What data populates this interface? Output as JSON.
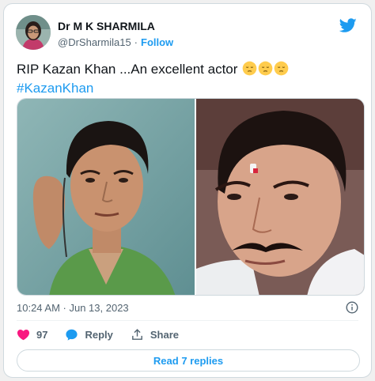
{
  "author": {
    "name": "Dr M K SHARMILA",
    "handle": "@DrSharmila15",
    "separator": "·",
    "follow_label": "Follow"
  },
  "tweet": {
    "text": "RIP Kazan Khan ...An excellent actor",
    "emoji_count": 3,
    "hashtag": "#KazanKhan",
    "timestamp": "10:24 AM · Jun 13, 2023"
  },
  "actions": {
    "like_count": "97",
    "reply_label": "Reply",
    "share_label": "Share"
  },
  "read_replies_label": "Read 7 replies",
  "colors": {
    "accent": "#1d9bf0",
    "like": "#f91880",
    "text": "#0f1419",
    "muted": "#536471"
  },
  "icons": [
    "twitter-bird-icon",
    "info-icon",
    "heart-icon",
    "reply-bubble-icon",
    "share-icon",
    "pensive-emoji-icon"
  ]
}
